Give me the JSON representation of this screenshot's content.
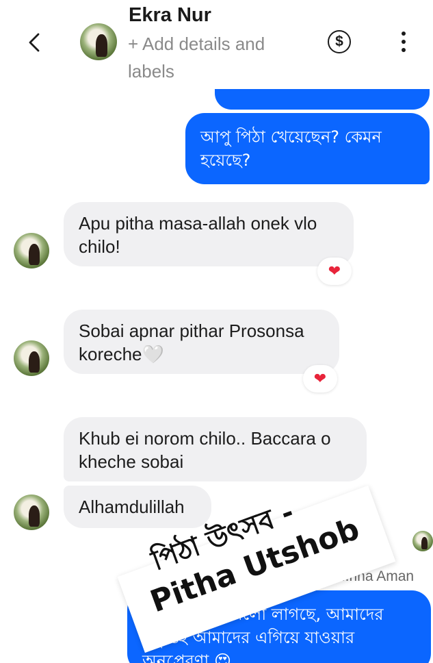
{
  "header": {
    "contact_name": "Ekra Nur",
    "add_details": "+ Add details and labels",
    "dollar_symbol": "$"
  },
  "messages": {
    "out1": "আপু পিঠা খেয়েছেন? কেমন হয়েছে?",
    "in1": "Apu pitha masa-allah onek vlo chilo!",
    "in2": "Sobai apnar pithar Prosonsa koreche🤍",
    "in3": "Khub ei norom chilo.. Baccara o kheche sobai",
    "in4": "Alhamdulillah",
    "sender_label": "...rina Aman",
    "out2": "আপু শুনেও ভালো লাগছে, আমাদের সন্তুষ্টিই আমাদের এগিয়ে যাওয়ার অনুপ্রেরণা 😍"
  },
  "reactions": {
    "r1": "❤",
    "r2": "❤"
  },
  "promo": {
    "line1": "পিঠা উৎসব -",
    "line2": "Pitha Utshob"
  },
  "colors": {
    "outgoing": "#0b66ff",
    "incoming": "#f0f0f2",
    "reaction": "#e8243a"
  }
}
